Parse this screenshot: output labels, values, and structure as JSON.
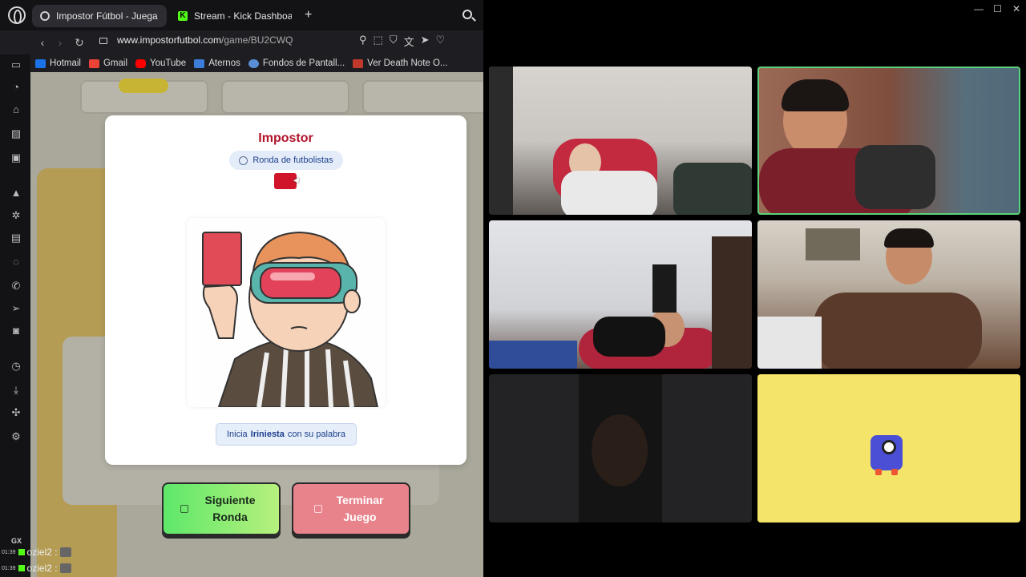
{
  "browser": {
    "tabs": [
      {
        "label": "Impostor Fútbol - Juega c",
        "active": true
      },
      {
        "label": "Stream - Kick Dashboard",
        "active": false
      }
    ],
    "url_host": "www.impostorfutbol.com",
    "url_path": "/game/BU2CWQ",
    "bookmarks": [
      {
        "label": "Hotmail",
        "color": "#1a73e8"
      },
      {
        "label": "Gmail",
        "color": "#ea4335"
      },
      {
        "label": "YouTube",
        "color": "#ff0000"
      },
      {
        "label": "Aternos",
        "color": "#3b7dd8"
      },
      {
        "label": "Fondos de Pantall...",
        "color": "#5a8fd6"
      },
      {
        "label": "Ver Death Note O...",
        "color": "#c0392b"
      }
    ]
  },
  "game": {
    "title": "Impostor",
    "round_pill": "Ronda de futbolistas",
    "start_prefix": "Inicia",
    "start_player": "Iriniesta",
    "start_suffix": "con su palabra",
    "next_button": "Siguiente Ronda",
    "end_button": "Terminar Juego",
    "card_color": "#d0142a"
  },
  "chat": {
    "lines": [
      {
        "time": "01:39",
        "user": "oziel2 :"
      },
      {
        "time": "01:39",
        "user": "oziel2 :"
      }
    ],
    "gx_label": "GX"
  },
  "window_controls": {
    "minimize": "—",
    "maximize": "☐",
    "close": "✕"
  }
}
